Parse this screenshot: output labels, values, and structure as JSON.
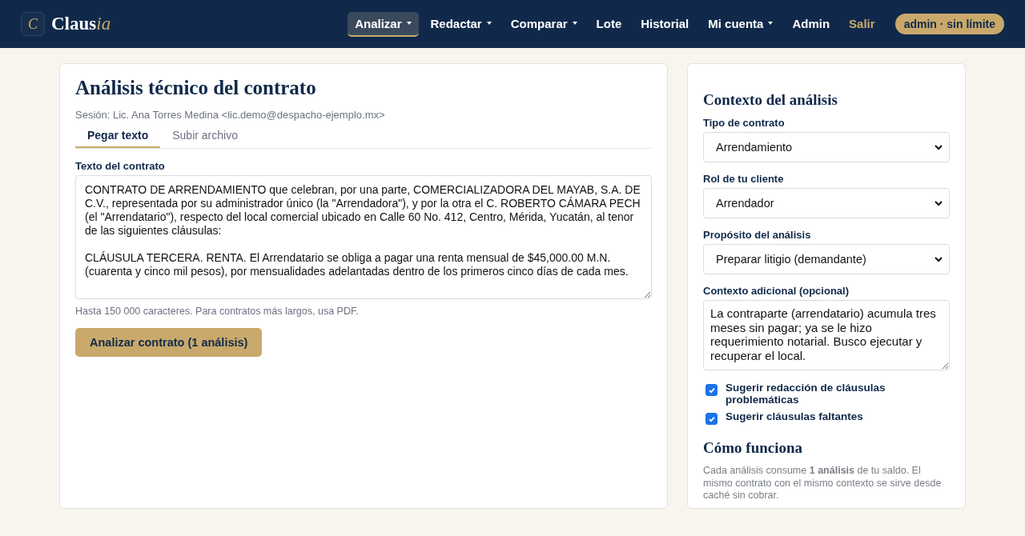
{
  "brand": {
    "mark": "C",
    "name": "Claus",
    "name_accent": "ia"
  },
  "nav": [
    {
      "label": "Analizar",
      "dropdown": true,
      "selected": true,
      "kind": "link"
    },
    {
      "label": "Redactar",
      "dropdown": true,
      "selected": false,
      "kind": "link"
    },
    {
      "label": "Comparar",
      "dropdown": true,
      "selected": false,
      "kind": "link"
    },
    {
      "label": "Lote",
      "dropdown": false,
      "selected": false,
      "kind": "link"
    },
    {
      "label": "Historial",
      "dropdown": false,
      "selected": false,
      "kind": "link"
    },
    {
      "label": "Mi cuenta",
      "dropdown": true,
      "selected": false,
      "kind": "link"
    },
    {
      "label": "Admin",
      "dropdown": false,
      "selected": false,
      "kind": "link"
    },
    {
      "label": "Salir",
      "dropdown": false,
      "selected": false,
      "kind": "logout"
    }
  ],
  "account_badge": "admin · sin límite",
  "main": {
    "title": "Análisis técnico del contrato",
    "session": "Sesión: Lic. Ana Torres Medina <lic.demo@despacho-ejemplo.mx>",
    "tabs": [
      {
        "label": "Pegar texto",
        "selected": true
      },
      {
        "label": "Subir archivo",
        "selected": false
      }
    ],
    "text_label": "Texto del contrato",
    "text_value": "CONTRATO DE ARRENDAMIENTO que celebran, por una parte, COMERCIALIZADORA DEL MAYAB, S.A. DE C.V., representada por su administrador único (la \"Arrendadora\"), y por la otra el C. ROBERTO CÁMARA PECH (el \"Arrendatario\"), respecto del local comercial ubicado en Calle 60 No. 412, Centro, Mérida, Yucatán, al tenor de las siguientes cláusulas:\n\nCLÁUSULA TERCERA. RENTA. El Arrendatario se obliga a pagar una renta mensual de $45,000.00 M.N. (cuarenta y cinco mil pesos), por mensualidades adelantadas dentro de los primeros cinco días de cada mes.",
    "hint": "Hasta 150 000 caracteres. Para contratos más largos, usa PDF.",
    "submit": "Analizar contrato (1 análisis)"
  },
  "sidebar": {
    "title": "Contexto del análisis",
    "selects": [
      {
        "label": "Tipo de contrato",
        "value": "Arrendamiento"
      },
      {
        "label": "Rol de tu cliente",
        "value": "Arrendador"
      },
      {
        "label": "Propósito del análisis",
        "value": "Preparar litigio (demandante)"
      }
    ],
    "context_label": "Contexto adicional (opcional)",
    "context_value": "La contraparte (arrendatario) acumula tres meses sin pagar; ya se le hizo requerimiento notarial. Busco ejecutar y recuperar el local.",
    "options": [
      {
        "label": "Sugerir redacción de cláusulas problemáticas",
        "checked": true
      },
      {
        "label": "Sugerir cláusulas faltantes",
        "checked": true
      }
    ],
    "how_title": "Cómo funciona",
    "how_text": "Cada análisis consume **1 análisis** de tu saldo. El mismo contrato con el mismo contexto se sirve desde caché sin cobrar."
  }
}
